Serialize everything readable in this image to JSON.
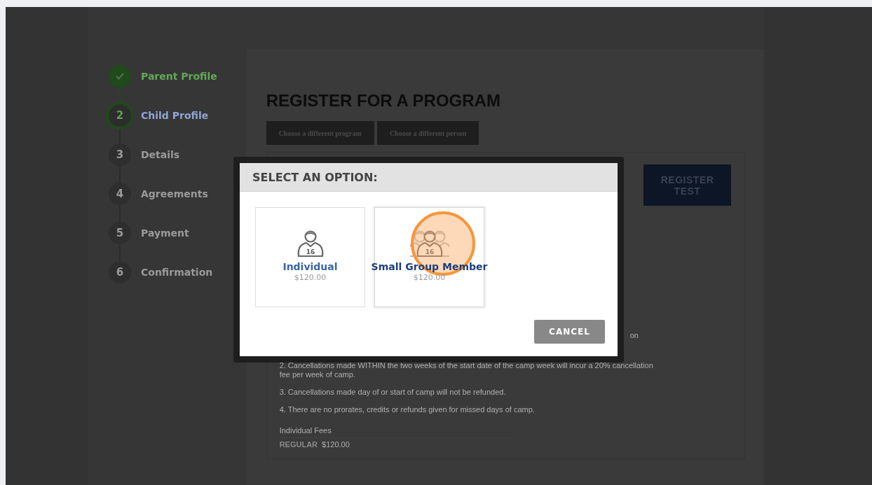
{
  "steps": [
    {
      "label": "Parent Profile",
      "completed": true,
      "current": false
    },
    {
      "number": "2",
      "label": "Child Profile",
      "completed": false,
      "current": true
    },
    {
      "number": "3",
      "label": "Details",
      "completed": false,
      "current": false
    },
    {
      "number": "4",
      "label": "Agreements",
      "completed": false,
      "current": false
    },
    {
      "number": "5",
      "label": "Payment",
      "completed": false,
      "current": false
    },
    {
      "number": "6",
      "label": "Confirmation",
      "completed": false,
      "current": false
    }
  ],
  "page": {
    "title": "REGISTER FOR A PROGRAM",
    "buttons": [
      "Choose a different program",
      "Choose a different person"
    ],
    "register_button": "REGISTER TEST",
    "policy_fragment": "on",
    "policies": [
      "2. Cancellations made WITHIN the two weeks of the start date of the camp week will incur a 20% cancellation fee per week of camp.",
      "3. Cancellations made day of or start of camp will not be refunded.",
      "4. There are no prorates, credits or refunds given for missed days of camp."
    ],
    "fees_title": "Individual Fees",
    "fees": [
      {
        "label": "REGULAR",
        "amount": "$120.00"
      }
    ]
  },
  "modal": {
    "title": "SELECT AN OPTION:",
    "options": [
      {
        "kind": "individual",
        "icon_text": "16",
        "name": "Individual",
        "price": "$120.00",
        "selected": false
      },
      {
        "kind": "group",
        "icon_text": "16",
        "name": "Small Group Member",
        "price": "$120.00",
        "selected": true
      }
    ],
    "cancel": "CANCEL"
  }
}
